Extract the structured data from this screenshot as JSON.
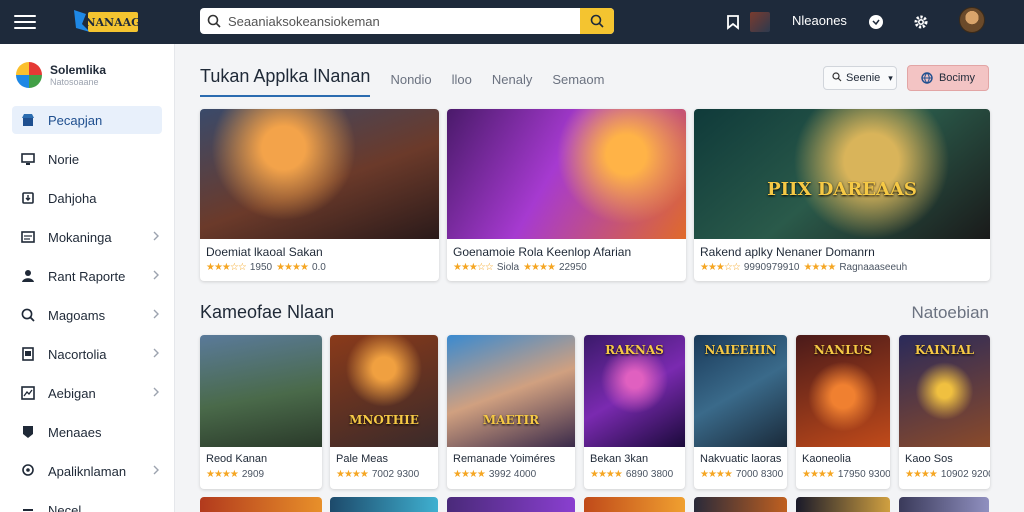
{
  "topbar": {
    "logo_text": "NANAAG",
    "search_placeholder": "Seaaniaksokeansiokeman",
    "user_name": "Nleaones",
    "icons": [
      "menu-icon",
      "search-icon",
      "bookmark-icon",
      "chat-icon",
      "gear-icon"
    ]
  },
  "sidebar": {
    "brand_title": "Solemlika",
    "brand_subtitle": "Natosoaane",
    "items": [
      {
        "label": "Pecapjan",
        "icon": "store-icon",
        "active": true,
        "chevron": false
      },
      {
        "label": "Norie",
        "icon": "monitor-icon",
        "active": false,
        "chevron": false
      },
      {
        "label": "Dahjoha",
        "icon": "download-icon",
        "active": false,
        "chevron": false
      },
      {
        "label": "Mokaninga",
        "icon": "list-icon",
        "active": false,
        "chevron": true
      },
      {
        "label": "Rant Raporte",
        "icon": "person-icon",
        "active": false,
        "chevron": true
      },
      {
        "label": "Magoams",
        "icon": "globe-icon",
        "active": false,
        "chevron": true
      },
      {
        "label": "Nacortolia",
        "icon": "document-icon",
        "active": false,
        "chevron": true
      },
      {
        "label": "Aebigan",
        "icon": "chart-icon",
        "active": false,
        "chevron": true
      },
      {
        "label": "Menaaes",
        "icon": "shield-icon",
        "active": false,
        "chevron": false
      },
      {
        "label": "Apaliknlaman",
        "icon": "location-icon",
        "active": false,
        "chevron": true
      },
      {
        "label": "Necel",
        "icon": "minus-icon",
        "active": false,
        "chevron": false
      }
    ]
  },
  "main": {
    "tabs": [
      {
        "label": "Tukan Applka lNanan",
        "active": true
      },
      {
        "label": "Nondio",
        "active": false
      },
      {
        "label": "lloo",
        "active": false
      },
      {
        "label": "Nenaly",
        "active": false
      },
      {
        "label": "Semaom",
        "active": false
      }
    ],
    "dropdown_label": "Seenie",
    "primary_button_label": "Bocimy",
    "featured": [
      {
        "title": "Doemiat lkaoal Sakan",
        "meta_left": "1950",
        "meta_right": "0.0",
        "thumb_text": ""
      },
      {
        "title": "Goenamoie Rola Keenlop Afarian",
        "meta_left": "Siola",
        "meta_right": "22950",
        "thumb_text": ""
      },
      {
        "title": "Rakend aplky Nenaner Domanrn",
        "meta_left": "9990979910",
        "meta_right": "Ragnaaaseeuh",
        "thumb_text": "PIIX DAREAAS"
      }
    ],
    "section_title": "Kameofae Nlaan",
    "section_link": "Natoebian",
    "grid": [
      {
        "title": "Reod Kanan",
        "meta": "2909",
        "thumb_text": ""
      },
      {
        "title": "Pale Meas",
        "meta": "7002 9300",
        "thumb_text": "MNOTHIE"
      },
      {
        "title": "Remanade Yoiméres",
        "meta": "3992 4000",
        "thumb_text": "MAETIR"
      },
      {
        "title": "Bekan 3kan",
        "meta": "6890 3800",
        "thumb_text": "RAKNAS"
      },
      {
        "title": "Nakvuatic laoras",
        "meta": "7000 8300",
        "thumb_text": "NAIEEHIN"
      },
      {
        "title": "Kaoneolia",
        "meta": "17950 9300",
        "thumb_text": "NANLUS"
      },
      {
        "title": "Kaoo Sos",
        "meta": "10902 9200",
        "thumb_text": "KAINIAL"
      }
    ]
  },
  "colors": {
    "topbar_bg": "#1e2a3b",
    "search_button": "#f4c430",
    "accent_blue": "#2b6cb0",
    "primary_button": "#f3c4c4",
    "star": "#f5a623"
  }
}
